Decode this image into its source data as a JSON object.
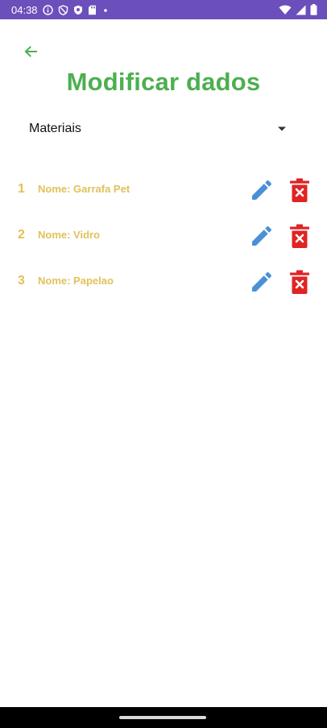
{
  "status_bar": {
    "time": "04:38",
    "icons_left": [
      "info-icon",
      "vpn-icon",
      "shield-icon",
      "sd-card-icon",
      "dot-icon"
    ],
    "icons_right": [
      "wifi-icon",
      "signal-icon",
      "battery-icon"
    ],
    "background_color": "#6b4fbb"
  },
  "header": {
    "back_icon": "arrow-left-icon",
    "title": "Modificar dados",
    "title_color": "#4caf50"
  },
  "category_select": {
    "selected": "Materiais",
    "caret_icon": "caret-down-icon"
  },
  "items": [
    {
      "index": "1",
      "name": "Nome: Garrafa Pet"
    },
    {
      "index": "2",
      "name": "Nome: Vidro"
    },
    {
      "index": "3",
      "name": "Nome: Papelao"
    }
  ],
  "colors": {
    "item_text": "#e2c15a",
    "edit_icon": "#4a90d9",
    "delete_icon": "#e02424"
  }
}
